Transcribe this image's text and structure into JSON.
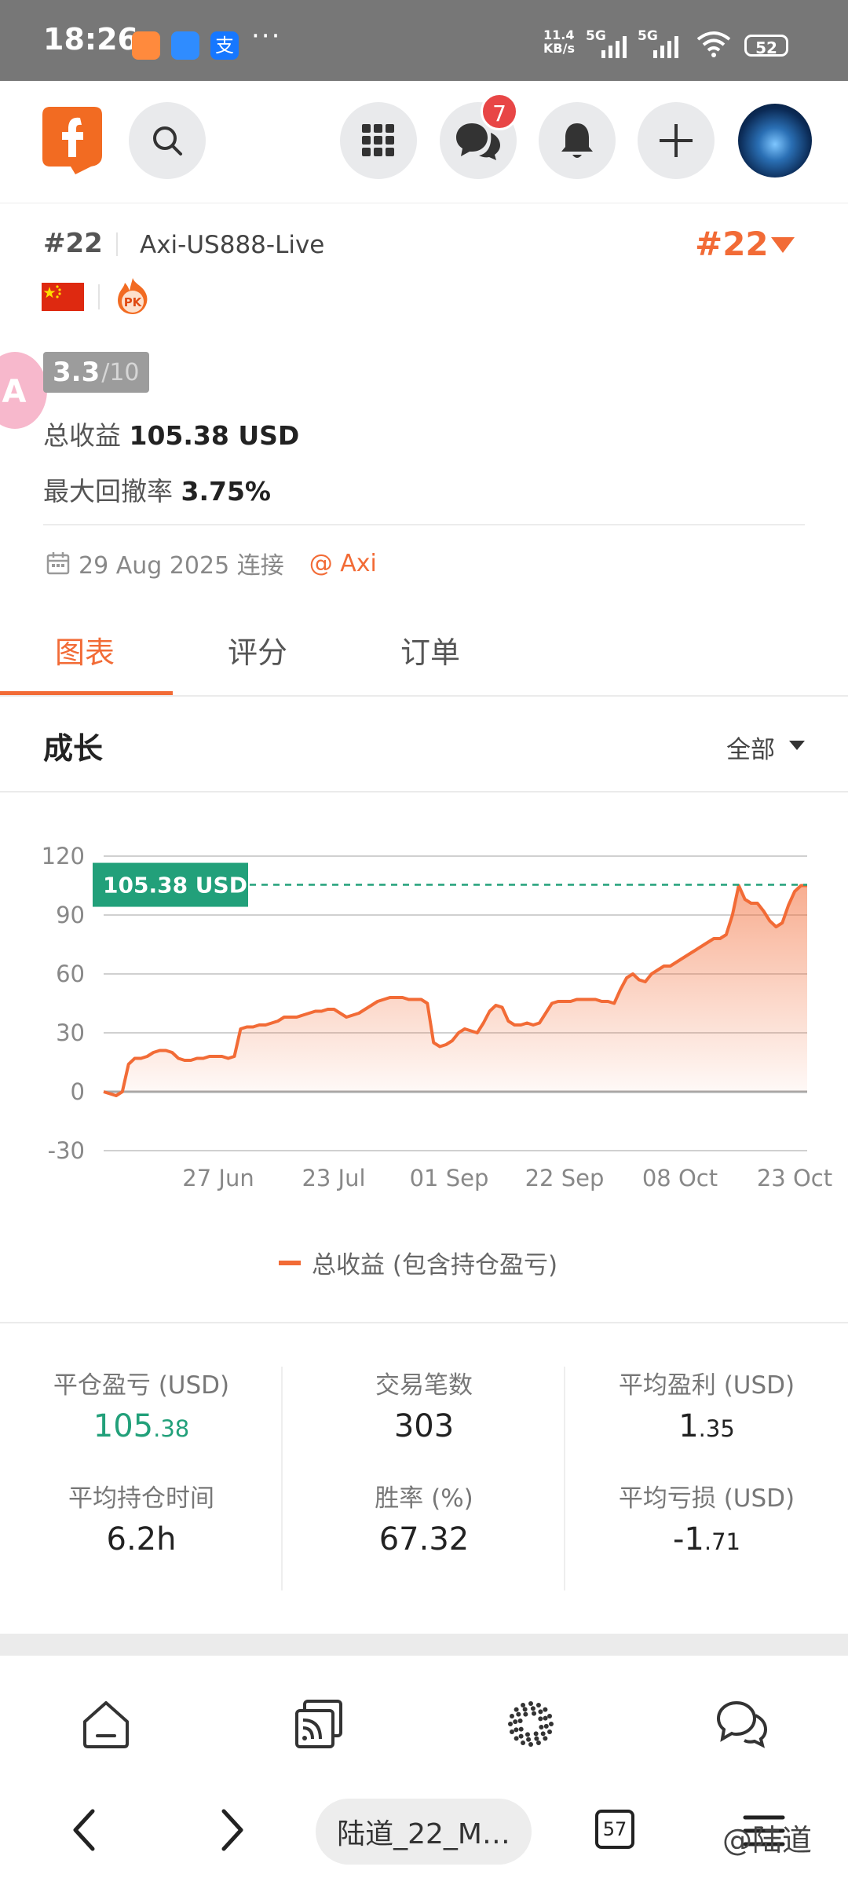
{
  "status_bar": {
    "time": "18:26",
    "net_speed_value": "11.4",
    "net_speed_unit": "KB/s",
    "sim1": "5G",
    "sim2": "5G",
    "battery": "52",
    "more": "···"
  },
  "header": {
    "message_badge": "7"
  },
  "account": {
    "rank_small": "#22",
    "account_name": "Axi-US888-Live",
    "rank_large": "#22",
    "pk_label": "PK",
    "rating_value": "3.3",
    "rating_max": "/10",
    "total_profit_label": "总收益",
    "total_profit_value": "105.38 USD",
    "max_drawdown_label": "最大回撤率",
    "max_drawdown_value": "3.75%",
    "connected_date": "29 Aug 2025 连接",
    "broker": "@ Axi"
  },
  "tabs": [
    {
      "label": "图表"
    },
    {
      "label": "评分"
    },
    {
      "label": "订单"
    }
  ],
  "growth": {
    "title": "成长",
    "filter": "全部"
  },
  "chart_data": {
    "type": "area",
    "y_ticks": [
      "120",
      "90",
      "60",
      "30",
      "0",
      "-30"
    ],
    "ylim": [
      -30,
      120
    ],
    "x_labels": [
      "27 Jun",
      "23 Jul",
      "01 Sep",
      "22 Sep",
      "08 Oct",
      "23 Oct"
    ],
    "current_value_label": "105.38 USD",
    "current_value": 105.38,
    "color": "#f26b36",
    "grid": true,
    "legend": "bottom-center",
    "series": [
      {
        "name": "总收益 (包含持仓盈亏)",
        "values": [
          0,
          -1,
          -2,
          0,
          14,
          17,
          17,
          18,
          20,
          21,
          21,
          20,
          17,
          16,
          16,
          17,
          17,
          18,
          18,
          18,
          17,
          18,
          32,
          33,
          33,
          34,
          34,
          35,
          36,
          38,
          38,
          38,
          39,
          40,
          41,
          41,
          42,
          42,
          40,
          38,
          39,
          40,
          42,
          44,
          46,
          47,
          48,
          48,
          48,
          47,
          47,
          47,
          45,
          25,
          23,
          24,
          26,
          30,
          32,
          31,
          30,
          35,
          41,
          44,
          43,
          36,
          34,
          34,
          35,
          34,
          35,
          40,
          45,
          46,
          46,
          46,
          47,
          47,
          47,
          47,
          46,
          46,
          45,
          52,
          58,
          60,
          57,
          56,
          60,
          62,
          64,
          64,
          66,
          68,
          70,
          72,
          74,
          76,
          78,
          78,
          80,
          90,
          105,
          98,
          96,
          96,
          92,
          87,
          84,
          86,
          95,
          102,
          105,
          105
        ]
      }
    ]
  },
  "legend_label": "总收益 (包含持仓盈亏)",
  "stats": [
    {
      "label": "平仓盈亏 (USD)",
      "int": "105",
      "dec": ".38",
      "green": true
    },
    {
      "label": "交易笔数",
      "int": "303",
      "dec": ""
    },
    {
      "label": "平均盈利 (USD)",
      "int": "1",
      "dec": ".35"
    },
    {
      "label": "平均持仓时间",
      "int": "6.2h",
      "dec": ""
    },
    {
      "label": "胜率 (%)",
      "int": "67.32",
      "dec": ""
    },
    {
      "label": "平均亏损 (USD)",
      "int": "-1",
      "dec": ".71"
    }
  ],
  "browser_bar": {
    "url_title": "陆道_22_M…",
    "tab_count": "57",
    "watermark": "@陆道"
  }
}
